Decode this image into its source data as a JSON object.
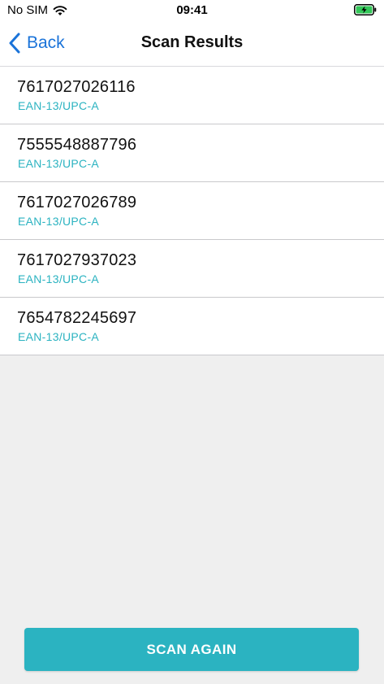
{
  "status_bar": {
    "carrier": "No SIM",
    "time": "09:41",
    "wifi_icon": "wifi-icon",
    "battery_icon": "battery-charging-icon",
    "battery_color": "#34c759"
  },
  "nav": {
    "back_label": "Back",
    "back_icon": "chevron-left-icon",
    "title": "Scan Results",
    "accent_color": "#1a73d9"
  },
  "results": [
    {
      "value": "7617027026116",
      "type": "EAN-13/UPC-A"
    },
    {
      "value": "7555548887796",
      "type": "EAN-13/UPC-A"
    },
    {
      "value": "7617027026789",
      "type": "EAN-13/UPC-A"
    },
    {
      "value": "7617027937023",
      "type": "EAN-13/UPC-A"
    },
    {
      "value": "7654782245697",
      "type": "EAN-13/UPC-A"
    }
  ],
  "type_color": "#2bb3c1",
  "footer": {
    "scan_again_label": "SCAN AGAIN",
    "button_color": "#2bb3c1"
  }
}
